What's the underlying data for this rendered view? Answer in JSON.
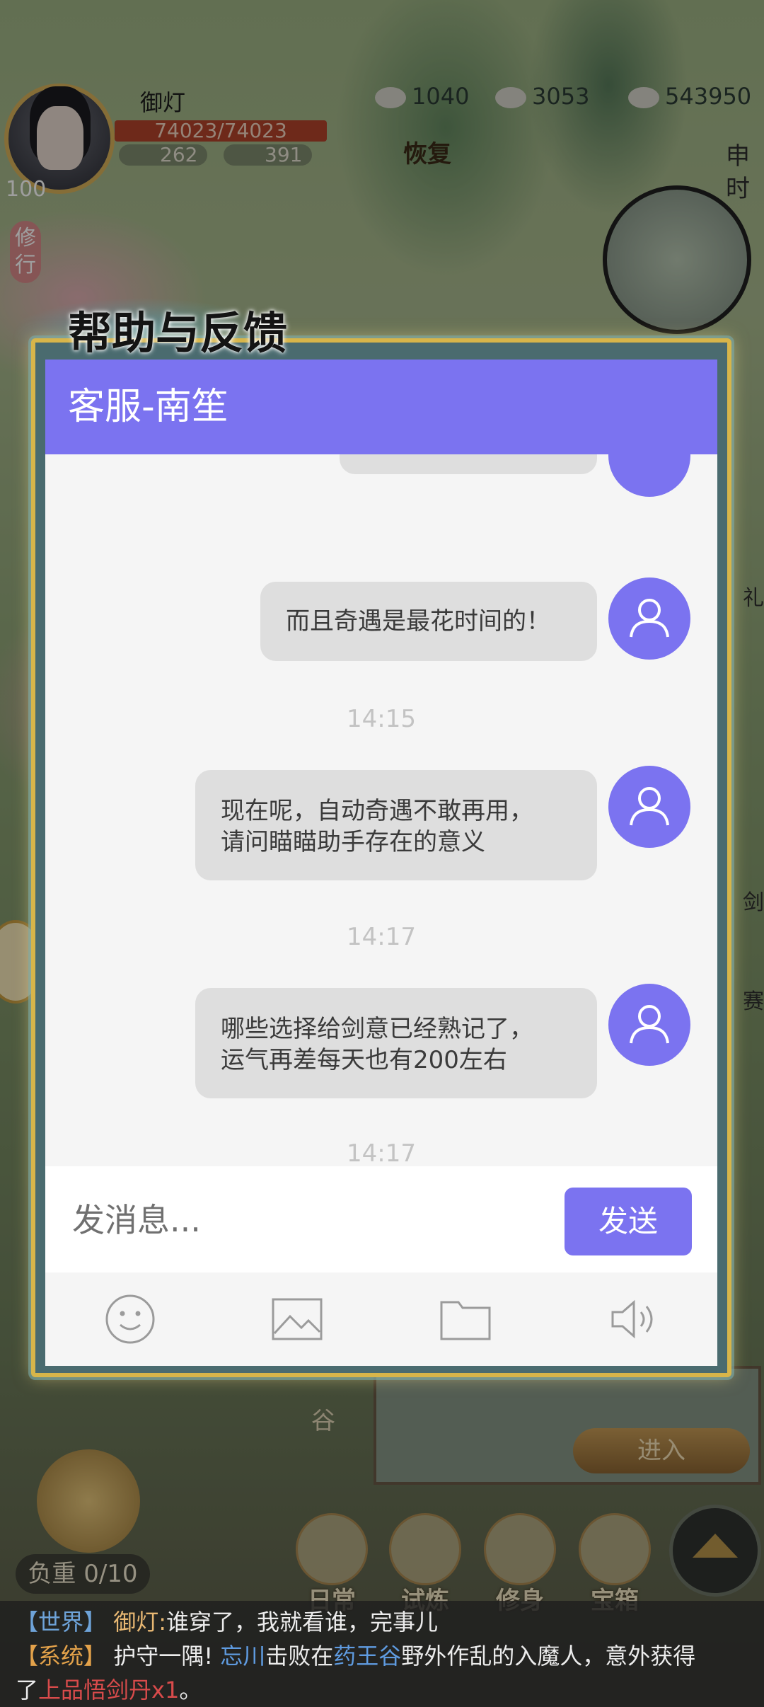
{
  "game": {
    "player_name": "御灯",
    "hp": "74023/74023",
    "level": "100",
    "stat1": "262",
    "stat2": "391",
    "resources": [
      "1040",
      "3053",
      "543950"
    ],
    "restore_label": "恢复",
    "time_label": "申时",
    "xiuxing_label": "修行",
    "right_side_labels": [
      "礼",
      "剑",
      "赛"
    ],
    "gu_label": "谷",
    "enter_label": "进入",
    "weight_label": "负重 0/10",
    "bottom_buttons": [
      "日常",
      "试炼",
      "修身",
      "宝箱"
    ]
  },
  "dialog": {
    "title": "帮助与反馈",
    "header": "客服-南笙"
  },
  "messages": [
    {
      "text_lines": [
        "而且奇遇是最花时间的！"
      ]
    },
    {
      "time": "14:15",
      "text_lines": [
        "现在呢，自动奇遇不敢再用，",
        "请问瞄瞄助手存在的意义"
      ]
    },
    {
      "time": "14:17",
      "text_lines": [
        "哪些选择给剑意已经熟记了，",
        "运气再差每天也有200左右"
      ]
    },
    {
      "time": "14:17"
    }
  ],
  "input": {
    "placeholder": "发消息...",
    "send_label": "发送"
  },
  "toolbar_icons": [
    "smiley-icon",
    "image-icon",
    "folder-icon",
    "speaker-icon"
  ],
  "chat_log": {
    "line1": {
      "tag": "【世界】",
      "speaker": "御灯:",
      "text": "谁穿了，我就看谁，完事儿"
    },
    "line2": {
      "tag": "【系统】",
      "pre": "护守一隅! ",
      "name": "忘川",
      "mid": "击败在",
      "place": "药王谷",
      "post": "野外作乱的入魔人，意外获得"
    },
    "line3": {
      "pre": "了",
      "item": "上品悟剑丹x1",
      "post": "。"
    }
  },
  "colors": {
    "accent": "#7b73f0",
    "bubble": "#dedede",
    "frame_gold": "#d7b54a"
  }
}
